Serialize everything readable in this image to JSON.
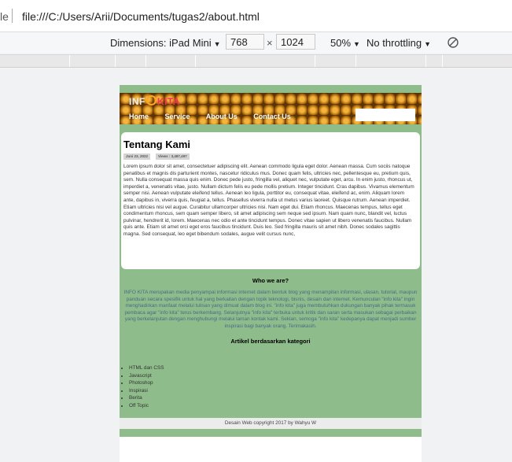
{
  "browser": {
    "file_label": "le",
    "url": "file:///C:/Users/Arii/Documents/tugas2/about.html"
  },
  "device_toolbar": {
    "dimensions_label": "Dimensions: iPad Mini",
    "width": "768",
    "times": "×",
    "height": "1024",
    "zoom": "50%",
    "throttling": "No throttling",
    "caret": "▼"
  },
  "site": {
    "logo_info": "INF",
    "logo_kita": "KITA",
    "nav": [
      "Home",
      "Service",
      "About Us",
      "Contact Us"
    ],
    "article": {
      "title": "Tentang Kami",
      "date": "Juni 23, 2022",
      "views": "Views : 3,487,497",
      "body": "Lorem ipsum dolor sit amet, consectetuer adipiscing elit. Aenean commodo ligula eget dolor. Aenean massa. Cum sociis natoque penatibus et magnis dis parturient montes, nascetur ridiculus mus. Donec quam felis, ultricies nec, pellentesque eu, pretium quis, sem. Nulla consequat massa quis enim. Donec pede justo, fringilla vel, aliquet nec, vulputate eget, arcu. In enim justo, rhoncus ut, imperdiet a, venenatis vitae, justo. Nullam dictum felis eu pede mollis pretium. Integer tincidunt. Cras dapibus. Vivamus elementum semper nisi. Aenean vulputate eleifend tellus. Aenean leo ligula, porttitor eu, consequat vitae, eleifend ac, enim. Aliquam lorem ante, dapibus in, viverra quis, feugiat a, tellus. Phasellus viverra nulla ut metus varius laoreet. Quisque rutrum. Aenean imperdiet. Etiam ultricies nisi vel augue. Curabitur ullamcorper ultricies nisi. Nam eget dui. Etiam rhoncus. Maecenas tempus, tellus eget condimentum rhoncus, sem quam semper libero, sit amet adipiscing sem neque sed ipsum. Nam quam nunc, blandit vel, luctus pulvinar, hendrerit id, lorem. Maecenas nec odio et ante tincidunt tempus. Donec vitae sapien ut libero venenatis faucibus. Nullam quis ante. Etiam sit amet orci eget eros faucibus tincidunt. Duis leo. Sed fringilla mauris sit amet nibh. Donec sodales sagittis magna. Sed consequat, leo eget bibendum sodales, augue velit cursus nunc,"
    },
    "who_title": "Who we are?",
    "who_text": "INFO KITA merupakan media penyampai informasi internet dalam bentuk blog yang menampilan informasi, ulasan, tutorial, maupun panduan secara spesifik untuk hal yang berkaitan dengan topik teknologi, bisnis, desain dan internet. Kemunculan \"info kita\" ingin menghadirkan manfaat melalui tulisan yang dimuat dalam blog ini. \"info kita\" juga membutuhkan dukungan banyak pihak termasuk pembaca agar \"info kita\" terus berkembang. Selanjutnya \"info kita\" terbuka untuk kritik dan saran serta masukan sebagai perbaikan yang berkelanjutan dengan menghubungi melalui laman kontak kami. Sekian, semoga \"info kita\" kedepanya dapat menjadi sumber inspirasi bagi banyak orang. Terimakasih.",
    "categories_title": "Artikel berdasarkan kategori",
    "categories": [
      "HTML dan CSS",
      "Javascript",
      "Photoshop",
      "Inspirasi",
      "Berita",
      "Off Topic"
    ],
    "copyright": "Desain Web copyright 2017 by Wahyu W"
  }
}
